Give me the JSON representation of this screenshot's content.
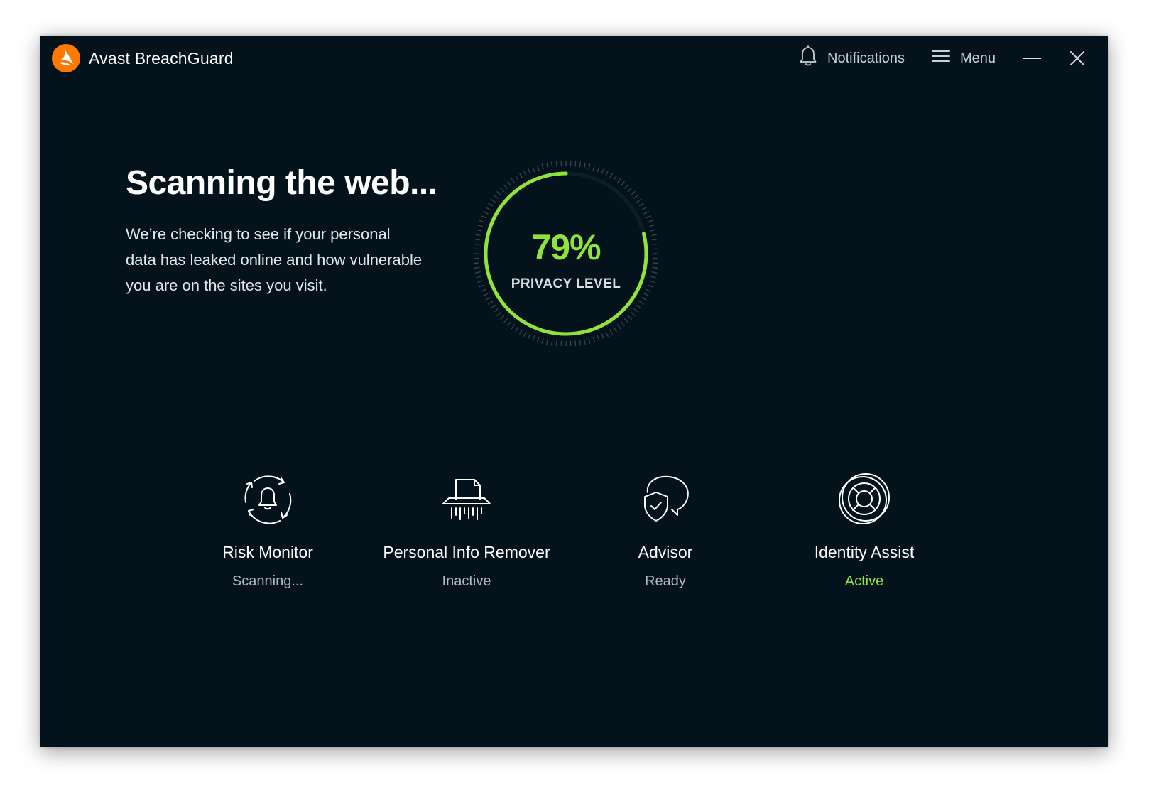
{
  "app": {
    "title": "Avast BreachGuard",
    "logo_icon": "avast-logo-icon",
    "brand_color": "#ff7800"
  },
  "top_actions": {
    "notifications_label": "Notifications",
    "notifications_icon": "bell-icon",
    "menu_label": "Menu",
    "menu_icon": "hamburger-icon",
    "minimize_icon": "minimize-icon",
    "close_icon": "close-icon"
  },
  "hero": {
    "title": "Scanning the web...",
    "description": "We’re checking to see if your personal data has leaked online and how vulnerable you are on the sites you visit."
  },
  "gauge": {
    "value_text": "79%",
    "label": "PRIVACY LEVEL",
    "progress_fraction": 0.79,
    "accent_color": "#8fe33b"
  },
  "features": [
    {
      "name": "Risk Monitor",
      "status": "Scanning...",
      "icon": "bell-refresh-icon",
      "status_color": "#b3bcc3"
    },
    {
      "name": "Personal Info Remover",
      "status": "Inactive",
      "icon": "shredder-icon",
      "status_color": "#b3bcc3"
    },
    {
      "name": "Advisor",
      "status": "Ready",
      "icon": "shield-chat-icon",
      "status_color": "#b3bcc3"
    },
    {
      "name": "Identity Assist",
      "status": "Active",
      "icon": "lifebuoy-icon",
      "status_color": "#8fe33b"
    }
  ],
  "colors": {
    "window_bg": "#03121b",
    "accent_green": "#8fe33b",
    "muted_text": "#b3bcc3"
  }
}
